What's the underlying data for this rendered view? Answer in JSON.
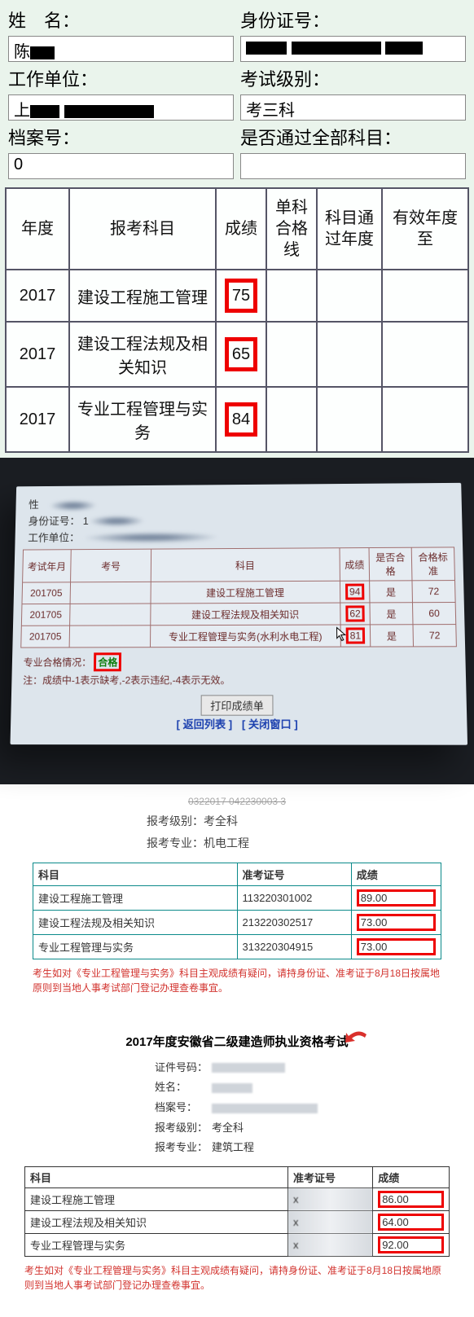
{
  "s1": {
    "labels": {
      "name": "姓　名：",
      "id": "身份证号：",
      "work": "工作单位：",
      "exam": "考试级别：",
      "file": "档案号：",
      "passall": "是否通过全部科目："
    },
    "values": {
      "exam": "考三科",
      "file": "0"
    },
    "headers": [
      "年度",
      "报考科目",
      "成绩",
      "单科合格线",
      "科目通过年度",
      "有效年度至"
    ],
    "rows": [
      {
        "year": "2017",
        "subject": "建设工程施工管理",
        "score": "75"
      },
      {
        "year": "2017",
        "subject": "建设工程法规及相关知识",
        "score": "65"
      },
      {
        "year": "2017",
        "subject": "专业工程管理与实务",
        "score": "84"
      }
    ]
  },
  "s2": {
    "labels": {
      "name": "性　",
      "id": "身份证号：",
      "work": "工作单位："
    },
    "headers": [
      "考试年月",
      "考号",
      "科目",
      "成绩",
      "是否合格",
      "合格标准"
    ],
    "rows": [
      {
        "ym": "201705",
        "subject": "建设工程施工管理",
        "score": "94",
        "pass": "是",
        "std": "72"
      },
      {
        "ym": "201705",
        "subject": "建设工程法规及相关知识",
        "score": "62",
        "pass": "是",
        "std": "60"
      },
      {
        "ym": "201705",
        "subject": "专业工程管理与实务(水利水电工程)",
        "score": "81",
        "pass": "是",
        "std": "72"
      }
    ],
    "status_label": "专业合格情况：",
    "status_value": "合格",
    "note": "注：成绩中-1表示缺考,-2表示违纪,-4表示无效。",
    "btn_print": "打印成绩单",
    "link_back": "[ 返回列表 ]",
    "link_close": "[ 关闭窗口 ]"
  },
  "s3": {
    "meta_level_label": "报考级别：",
    "meta_level": "考全科",
    "meta_major_label": "报考专业：",
    "meta_major": "机电工程",
    "headers": [
      "科目",
      "准考证号",
      "成绩"
    ],
    "rows": [
      {
        "subject": "建设工程施工管理",
        "ticket": "113220301002",
        "score": "89.00"
      },
      {
        "subject": "建设工程法规及相关知识",
        "ticket": "213220302517",
        "score": "73.00"
      },
      {
        "subject": "专业工程管理与实务",
        "ticket": "313220304915",
        "score": "73.00"
      }
    ],
    "note": "考生如对《专业工程管理与实务》科目主观成绩有疑问，请持身份证、准考证于8月18日按属地原则到当地人事考试部门登记办理查卷事宜。"
  },
  "s4": {
    "title": "2017年度安徽省二级建造师执业资格考试",
    "labels": {
      "cert": "证件号码：",
      "name": "姓名：",
      "file": "档案号：",
      "level": "报考级别：",
      "major": "报考专业："
    },
    "values": {
      "level": "考全科",
      "major": "建筑工程"
    },
    "headers": [
      "科目",
      "准考证号",
      "成绩"
    ],
    "rows": [
      {
        "subject": "建设工程施工管理",
        "score": "86.00"
      },
      {
        "subject": "建设工程法规及相关知识",
        "score": "64.00"
      },
      {
        "subject": "专业工程管理与实务",
        "score": "92.00"
      }
    ],
    "note": "考生如对《专业工程管理与实务》科目主观成绩有疑问，请持身份证、准考证于8月18日按属地原则到当地人事考试部门登记办理查卷事宜。"
  },
  "chart_data": [
    {
      "type": "table",
      "title": "Section1 exam scores 2017",
      "columns": [
        "年度",
        "报考科目",
        "成绩",
        "单科合格线",
        "科目通过年度",
        "有效年度至"
      ],
      "rows": [
        [
          "2017",
          "建设工程施工管理",
          "75",
          "",
          "",
          ""
        ],
        [
          "2017",
          "建设工程法规及相关知识",
          "65",
          "",
          "",
          ""
        ],
        [
          "2017",
          "专业工程管理与实务",
          "84",
          "",
          "",
          ""
        ]
      ]
    },
    {
      "type": "table",
      "title": "Section2 score sheet 201705",
      "columns": [
        "考试年月",
        "考号",
        "科目",
        "成绩",
        "是否合格",
        "合格标准"
      ],
      "rows": [
        [
          "201705",
          "",
          "建设工程施工管理",
          "94",
          "是",
          "72"
        ],
        [
          "201705",
          "",
          "建设工程法规及相关知识",
          "62",
          "是",
          "60"
        ],
        [
          "201705",
          "",
          "专业工程管理与实务(水利水电工程)",
          "81",
          "是",
          "72"
        ]
      ]
    },
    {
      "type": "table",
      "title": "Section3 机电工程 考全科",
      "columns": [
        "科目",
        "准考证号",
        "成绩"
      ],
      "rows": [
        [
          "建设工程施工管理",
          "113220301002",
          "89.00"
        ],
        [
          "建设工程法规及相关知识",
          "213220302517",
          "73.00"
        ],
        [
          "专业工程管理与实务",
          "313220304915",
          "73.00"
        ]
      ]
    },
    {
      "type": "table",
      "title": "Section4 安徽省 建筑工程 考全科",
      "columns": [
        "科目",
        "准考证号",
        "成绩"
      ],
      "rows": [
        [
          "建设工程施工管理",
          "",
          "86.00"
        ],
        [
          "建设工程法规及相关知识",
          "",
          "64.00"
        ],
        [
          "专业工程管理与实务",
          "",
          "92.00"
        ]
      ]
    }
  ]
}
